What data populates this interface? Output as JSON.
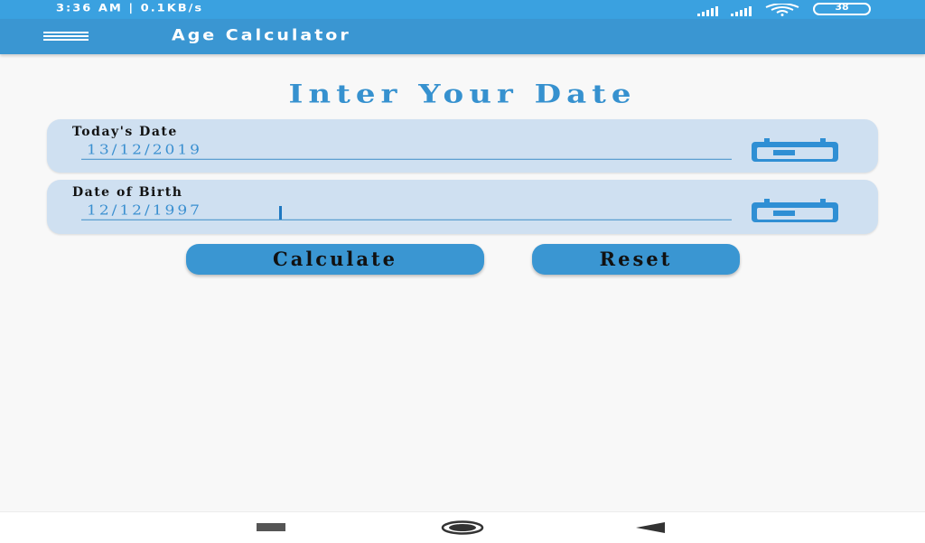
{
  "status_bar": {
    "time_speed": "3:36 AM | 0.1KB/s",
    "battery_level": "38",
    "icons": [
      "signal-icon",
      "signal-icon",
      "wifi-icon",
      "battery-icon"
    ]
  },
  "app_bar": {
    "title": "Age Calculator",
    "menu_icon": "hamburger-menu-icon"
  },
  "heading": "Inter Your Date",
  "fields": {
    "today": {
      "label": "Today's Date",
      "value": "13/12/2019",
      "icon": "calendar-icon"
    },
    "dob": {
      "label": "Date of Birth",
      "value": "12/12/1997",
      "icon": "calendar-icon"
    }
  },
  "buttons": {
    "calculate": "Calculate",
    "reset": "Reset"
  },
  "nav_bar": {
    "icons": [
      "recent-apps-icon",
      "home-icon",
      "back-icon"
    ]
  },
  "colors": {
    "status_bar": "#3aa1e0",
    "app_bar": "#3a96d2",
    "accent": "#3691cf",
    "card": "#cfe0f1",
    "background": "#f8f8f8"
  }
}
